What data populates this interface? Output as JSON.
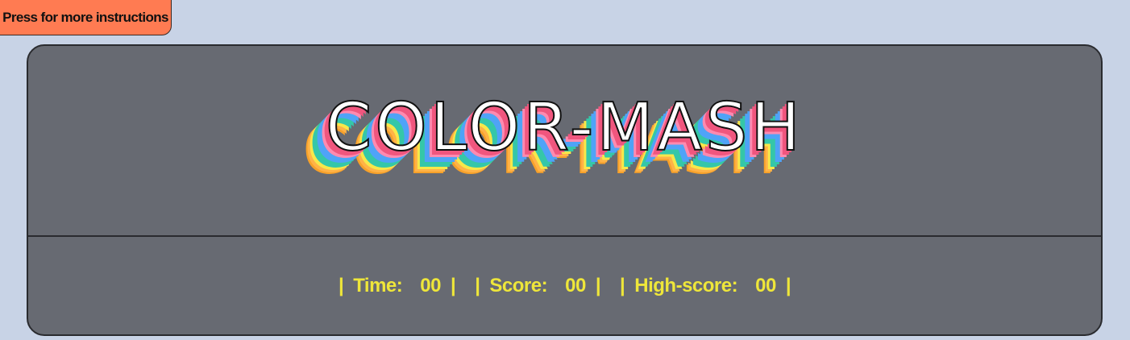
{
  "instructions_button": {
    "label": "Press for more instructions"
  },
  "game": {
    "title": "COLOR-MASH",
    "stats": {
      "time": {
        "label": "Time:",
        "value": "00"
      },
      "score": {
        "label": "Score:",
        "value": "00"
      },
      "high_score": {
        "label": "High-score:",
        "value": "00"
      },
      "separator": "|"
    }
  },
  "colors": {
    "page_background": "#c8d3e6",
    "button_background": "#ff7b52",
    "panel_background": "#676a72",
    "stat_text": "#eee63a",
    "title_shadow": [
      "#f0567e",
      "#ff8ab0",
      "#4fa3f7",
      "#35c7a8",
      "#f7e84a",
      "#ffb347"
    ]
  }
}
